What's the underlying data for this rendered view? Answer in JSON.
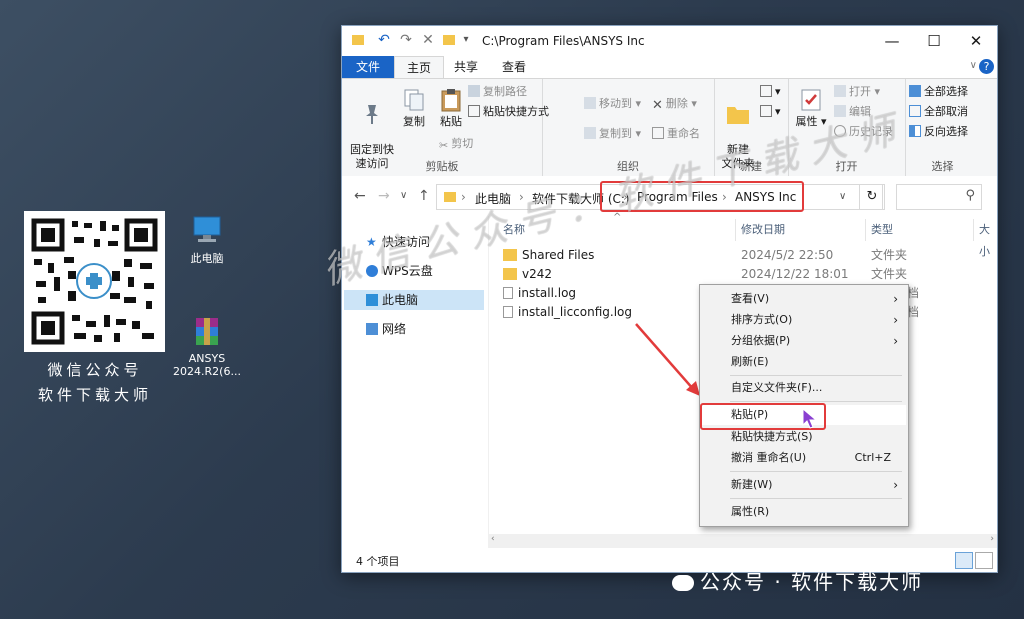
{
  "desktop": {
    "qr_caption_line1": "微信公众号",
    "qr_caption_line2": "软件下载大师",
    "icons": [
      {
        "label": "此电脑"
      },
      {
        "label": "ANSYS\n2024.R2(6..."
      }
    ]
  },
  "window": {
    "title": "C:\\Program Files\\ANSYS Inc",
    "ribbon_tabs": {
      "file": "文件",
      "home": "主页",
      "share": "共享",
      "view": "查看"
    },
    "help_icon": "?",
    "ribbon": {
      "clipboard": {
        "group_label": "剪贴板",
        "pin": "固定到快\n速访问",
        "copy": "复制",
        "paste": "粘贴",
        "copy_path": "复制路径",
        "paste_shortcut": "粘贴快捷方式",
        "cut": "剪切"
      },
      "organize": {
        "group_label": "组织",
        "move_to": "移动到",
        "delete": "删除",
        "copy_to": "复制到",
        "rename": "重命名"
      },
      "new": {
        "group_label": "新建",
        "new_folder": "新建\n文件夹"
      },
      "open": {
        "group_label": "打开",
        "properties": "属性",
        "open": "打开",
        "edit": "编辑",
        "history": "历史记录"
      },
      "select": {
        "group_label": "选择",
        "select_all": "全部选择",
        "select_none": "全部取消",
        "invert": "反向选择"
      }
    },
    "address": {
      "segments": [
        "此电脑",
        "软件下载大师 (C:)",
        "Program Files",
        "ANSYS Inc"
      ]
    },
    "nav": {
      "quick_access": "快速访问",
      "wps": "WPS云盘",
      "this_pc": "此电脑",
      "network": "网络"
    },
    "columns": {
      "name": "名称",
      "modified": "修改日期",
      "type": "类型",
      "size": "大小"
    },
    "files": [
      {
        "name": "Shared Files",
        "modified": "2024/5/2 22:50",
        "type": "文件夹"
      },
      {
        "name": "v242",
        "modified": "2024/12/22 18:01",
        "type": "文件夹"
      },
      {
        "name": "install.log",
        "modified": "",
        "type": "档"
      },
      {
        "name": "install_licconfig.log",
        "modified": "",
        "type": "档"
      }
    ],
    "status": "4 个项目"
  },
  "context_menu": {
    "view": "查看(V)",
    "sort": "排序方式(O)",
    "group": "分组依据(P)",
    "refresh": "刷新(E)",
    "customize": "自定义文件夹(F)...",
    "paste": "粘贴(P)",
    "paste_shortcut": "粘贴快捷方式(S)",
    "undo": "撤消 重命名(U)",
    "undo_shortcut": "Ctrl+Z",
    "new": "新建(W)",
    "properties": "属性(R)"
  },
  "overlay": {
    "watermark": "微信公众号：软件下载大师",
    "brand": "公众号 · 软件下载大师"
  },
  "colors": {
    "accent": "#1a64c6",
    "highlight": "#e23b3b",
    "selected": "#cce4f7",
    "folder": "#f3c54b"
  }
}
